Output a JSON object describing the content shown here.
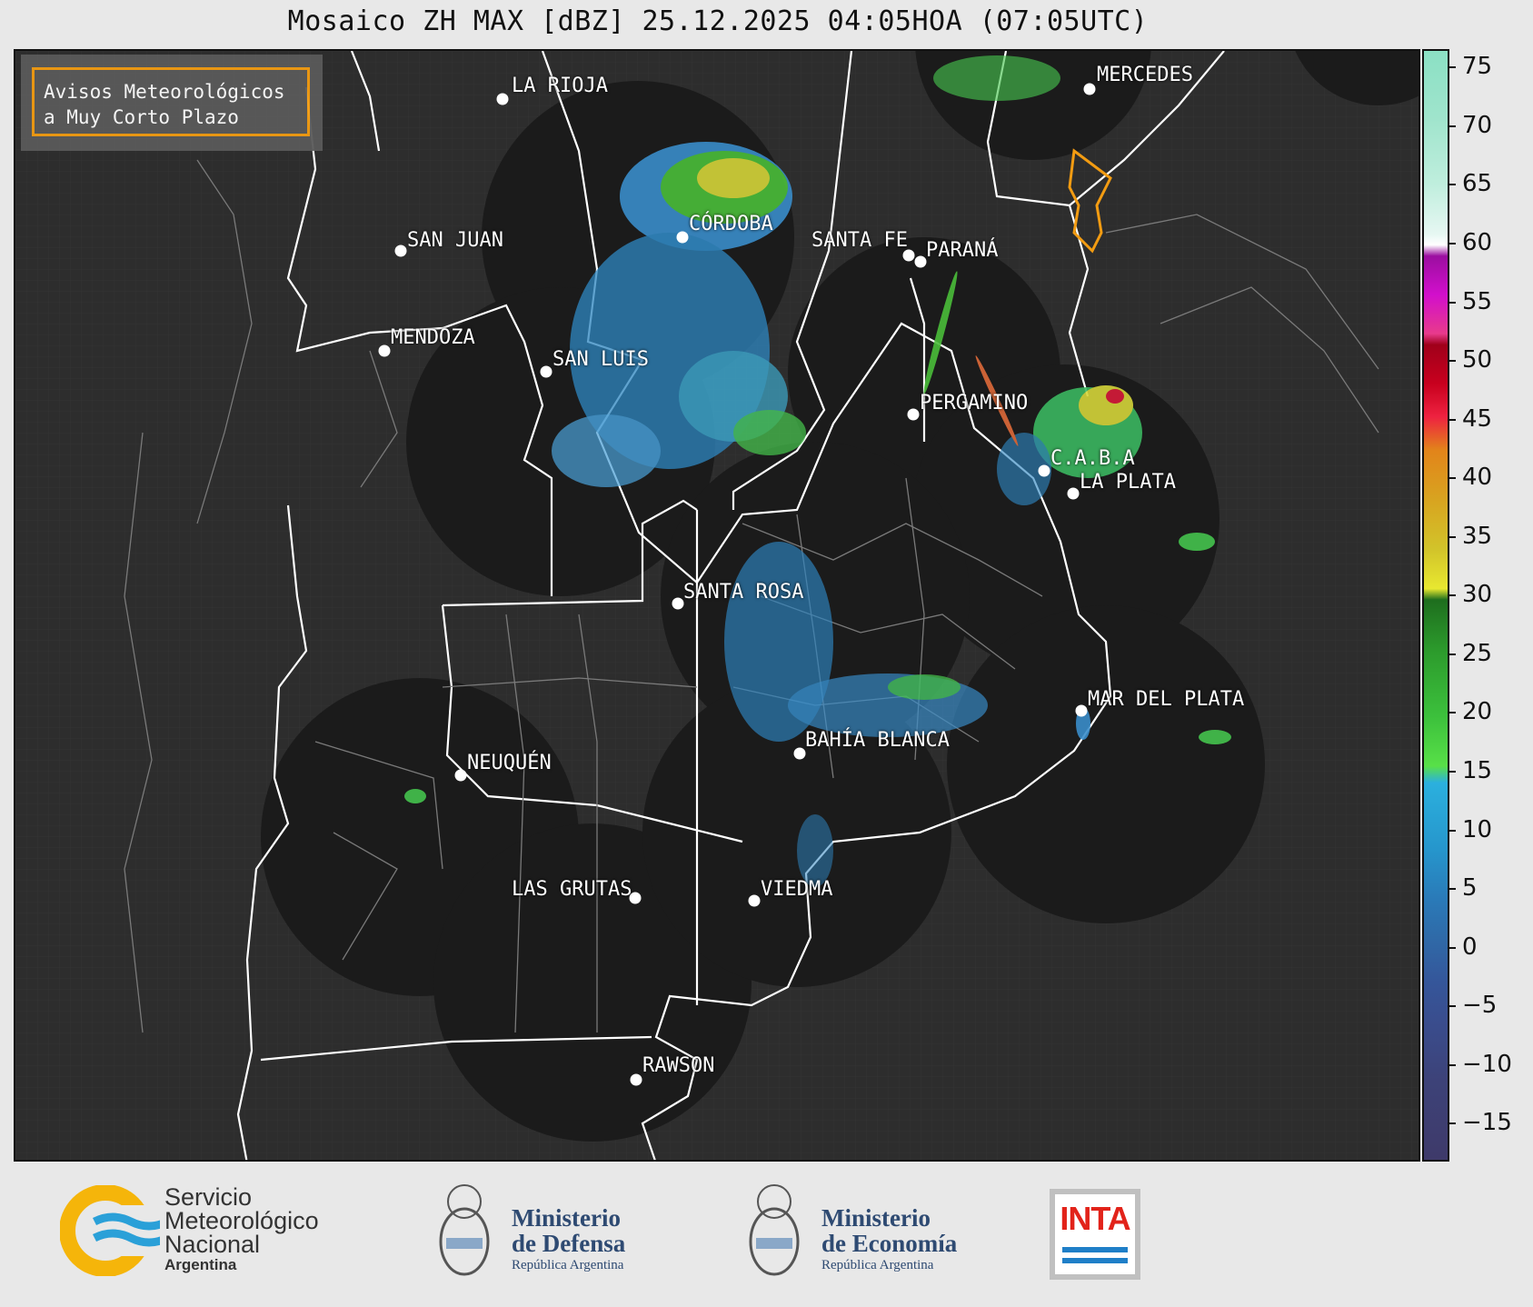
{
  "title": "Mosaico ZH MAX [dBZ] 25.12.2025 04:05HOA (07:05UTC)",
  "aviso": {
    "line1": "Avisos Meteorológicos",
    "line2": "a Muy Corto Plazo",
    "border_color": "#f39c12"
  },
  "cities": [
    {
      "name": "LA RIOJA",
      "id": "la-rioja"
    },
    {
      "name": "MERCEDES",
      "id": "mercedes"
    },
    {
      "name": "SAN JUAN",
      "id": "san-juan"
    },
    {
      "name": "CÓRDOBA",
      "id": "cordoba"
    },
    {
      "name": "SANTA FE",
      "id": "santa-fe"
    },
    {
      "name": "PARANÁ",
      "id": "parana"
    },
    {
      "name": "MENDOZA",
      "id": "mendoza"
    },
    {
      "name": "SAN LUIS",
      "id": "san-luis"
    },
    {
      "name": "PERGAMINO",
      "id": "pergamino"
    },
    {
      "name": "C.A.B.A",
      "id": "caba"
    },
    {
      "name": "LA PLATA",
      "id": "la-plata"
    },
    {
      "name": "SANTA ROSA",
      "id": "santa-rosa"
    },
    {
      "name": "MAR DEL PLATA",
      "id": "mar-del-plata"
    },
    {
      "name": "BAHÍA BLANCA",
      "id": "bahia-blanca"
    },
    {
      "name": "NEUQUÉN",
      "id": "neuquen"
    },
    {
      "name": "LAS GRUTAS",
      "id": "las-grutas"
    },
    {
      "name": "VIEDMA",
      "id": "viedma"
    },
    {
      "name": "RAWSON",
      "id": "rawson"
    }
  ],
  "colorbar": {
    "units": "dBZ",
    "ticks": [
      "75",
      "70",
      "65",
      "60",
      "55",
      "50",
      "45",
      "40",
      "35",
      "30",
      "25",
      "20",
      "15",
      "10",
      "5",
      "0",
      "−5",
      "−10",
      "−15"
    ],
    "range": [
      -18,
      76.5
    ]
  },
  "colors": {
    "background_map": "#2d2d2d",
    "radar_coverage": "#1b1b1b",
    "boundaries": "#ffffff"
  },
  "logos": {
    "smn": {
      "line1": "Servicio",
      "line2": "Meteorológico",
      "line3": "Nacional",
      "line4": "Argentina"
    },
    "defensa": {
      "line1": "Ministerio",
      "line2": "de Defensa",
      "line3": "República Argentina"
    },
    "economia": {
      "line1": "Ministerio",
      "line2": "de Economía",
      "line3": "República Argentina"
    },
    "inta": {
      "text": "INTA"
    }
  }
}
